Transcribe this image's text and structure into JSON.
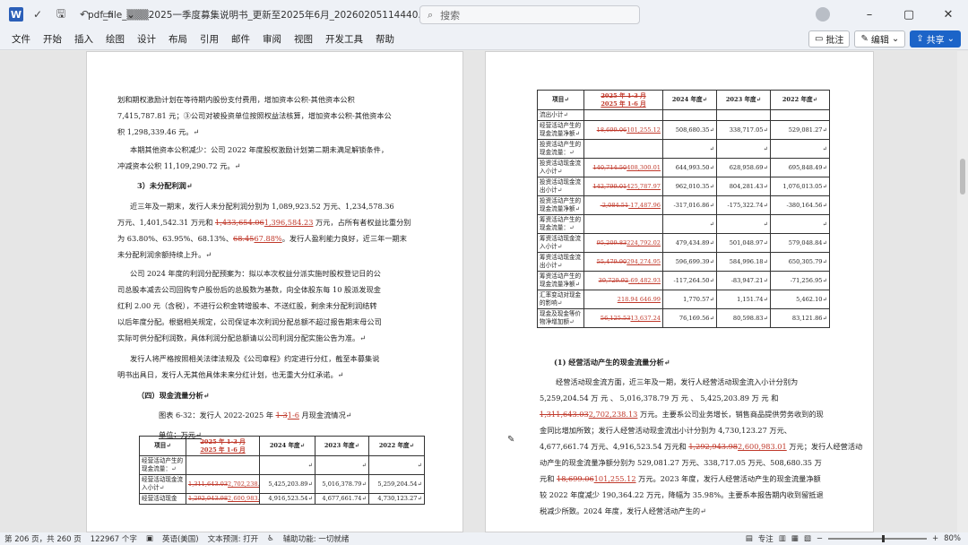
{
  "window": {
    "title": "pdf_file_▒▒▒2025一季度募集说明书_更新至2025年6月_20260205114440.docx - 兼容性...",
    "search_placeholder": "搜索"
  },
  "menu": [
    "文件",
    "开始",
    "插入",
    "绘图",
    "设计",
    "布局",
    "引用",
    "邮件",
    "审阅",
    "视图",
    "开发工具",
    "帮助"
  ],
  "ribbon_right": {
    "comment": "批注",
    "edit": "编辑",
    "share": "共享"
  },
  "left_page": {
    "p1a": "划和期权激励计划在等待期内股份支付费用，增加资本公积-其他资本公积",
    "p1b": "7,415,787.81 元；③公司对被投资单位按照权益法核算，增加资本公积-其他资本公",
    "p1c": "积 1,298,339.46 元。↵",
    "p2a": "本期其他资本公积减少：公司 2022 年度股权激励计划第二期未满足解锁条件，",
    "p2b": "冲减资本公积 11,109,290.72 元。↵",
    "h3": "3）未分配利润↵",
    "p3a": "近三年及一期末，发行人未分配利润分别为 1,089,923.52 万元、1,234,578.36",
    "p3b_1": "万元、1,401,542.31 万元和 ",
    "p3b_del": "1,433,654.06",
    "p3b_ins": "1,396,584.23",
    "p3b_2": " 万元，占所有者权益比重分别",
    "p3c_1": "为 63.80%、63.95%、68.13%、",
    "p3c_del": "68.45",
    "p3c_ins": "67.88%",
    "p3c_2": "。发行人盈利能力良好，近三年一期末",
    "p3d": "未分配利润余额持续上升。↵",
    "p4a": "公司 2024 年度的利润分配预案为：拟以本次权益分派实施时股权登记日的公",
    "p4b": "司总股本减去公司回购专户股份后的总股数为基数，向全体股东每 10 股派发现金",
    "p4c": "红利 2.00 元（含税），不进行公积金转增股本、不送红股，剩余未分配利润结转",
    "p4d": "以后年度分配。根据相关规定，公司保证本次利润分配总额不超过报告期末母公司",
    "p4e": "实际可供分配利润数，具体利润分配总额请以公司利润分配实施公告为准。↵",
    "p5a": "发行人将严格按照相关法律法规及《公司章程》约定进行分红，截至本募集说",
    "p5b": "明书出具日，发行人无其他具体未来分红计划，也无重大分红承诺。↵",
    "h4": "（四）现金流量分析↵",
    "cap_1": "图表 6-32：发行人 2022-2025 年 ",
    "cap_del": "1-3",
    "cap_ins": "1-6",
    "cap_2": " 月现金流情况↵",
    "unit": "单位：万元↵",
    "table": {
      "h0": "项目↵",
      "h1_del": "2025 年 1-3 月",
      "h1_ins": "2025 年 1-6 月",
      "h2": "2024 年度↵",
      "h3": "2023 年度↵",
      "h4": "2022 年度↵",
      "rows": [
        {
          "label": "经营活动产生的现金流量：↵",
          "del": "",
          "ins": "",
          "v2": "↵",
          "v3": "↵",
          "v4": "↵"
        },
        {
          "label": "经营活动现金流入小计↵",
          "del": "1,311,643.03",
          "ins": "2,702,238.13",
          "v2": "5,425,203.89↵",
          "v3": "5,016,378.79↵",
          "v4": "5,259,204.54↵"
        },
        {
          "label": "经营活动现金",
          "del": "1,292,943.98",
          "ins": "2,600,983.01",
          "v2": "4,916,523.54↵",
          "v3": "4,677,661.74↵",
          "v4": "4,730,123.27↵"
        }
      ]
    }
  },
  "right_page": {
    "table": {
      "h0": "项目↵",
      "h1_del": "2025 年 1-3 月",
      "h1_ins": "2025 年 1-6 月",
      "h2": "2024 年度↵",
      "h3": "2023 年度↵",
      "h4": "2022 年度↵",
      "rows": [
        {
          "label": "流出小计↵",
          "del": "",
          "ins": "",
          "v2": "",
          "v3": "",
          "v4": ""
        },
        {
          "label": "经营活动产生的现金流量净额↵",
          "del": "18,699.06",
          "ins": "101,255.12",
          "v2": "508,680.35↵",
          "v3": "338,717.05↵",
          "v4": "529,081.27↵"
        },
        {
          "label": "投资活动产生的现金流量：↵",
          "del": "",
          "ins": "",
          "v2": "↵",
          "v3": "↵",
          "v4": "↵"
        },
        {
          "label": "投资活动现金流入小计↵",
          "del": "140,714.50",
          "ins": "408,300.01",
          "v2": "644,993.50↵",
          "v3": "628,958.69↵",
          "v4": "695,848.49↵"
        },
        {
          "label": "投资活动现金流出小计↵",
          "del": "142,799.01",
          "ins": "425,787.97",
          "v2": "962,010.35↵",
          "v3": "804,281.43↵",
          "v4": "1,076,013.05↵"
        },
        {
          "label": "投资活动产生的现金流量净额↵",
          "del": "-2,084.51",
          "ins": "-17,487.96",
          "v2": "-317,016.86↵",
          "v3": "-175,322.74↵",
          "v4": "-380,164.56↵"
        },
        {
          "label": "筹资活动产生的现金流量：↵",
          "del": "",
          "ins": "",
          "v2": "↵",
          "v3": "↵",
          "v4": "↵"
        },
        {
          "label": "筹资活动现金流入小计↵",
          "del": "95,209.83",
          "ins": "224,792.02",
          "v2": "479,434.89↵",
          "v3": "501,048.97↵",
          "v4": "579,048.84↵"
        },
        {
          "label": "筹资活动现金流出小计↵",
          "del": "55,479.90",
          "ins": "294,274.95",
          "v2": "596,699.39↵",
          "v3": "584,996.18↵",
          "v4": "650,305.79↵"
        },
        {
          "label": "筹资活动产生的现金流量净额↵",
          "del": "39,729.92",
          "ins": "-69,482.93",
          "v2": "-117,264.50↵",
          "v3": "-83,947.21↵",
          "v4": "-71,256.95↵"
        },
        {
          "label": "汇率变动对现金的影响↵",
          "del": "",
          "ins": "218.94 646.99",
          "v2": "1,770.57↵",
          "v3": "1,151.74↵",
          "v4": "5,462.10↵"
        },
        {
          "label": "现金及现金等价物净增加额↵",
          "del": "56,125.53",
          "ins": "13,637.24",
          "v2": "76,169.56↵",
          "v3": "80,598.83↵",
          "v4": "83,121.86↵"
        }
      ]
    },
    "h1": "(1) 经营活动产生的现金流量分析↵",
    "q1": "经营活动现金流方面，近三年及一期，发行人经营活动现金流入小计分别为",
    "q2": "5,259,204.54     万   元   、  5,016,378.79   万   元   、  5,425,203.89   万   元   和",
    "q3_del": "1,311,643.03",
    "q3_ins": "2,702,238.13",
    "q3_2": " 万元。主要系公司业务增长，销售商品提供劳务收到的现",
    "q4": "金同比增加所致；发行人经营活动现金流出小计分别为 4,730,123.27 万元、",
    "q5_1": "4,677,661.74 万元、4,916,523.54 万元和 ",
    "q5_del": "1,292,943.98",
    "q5_ins": "2,600,983.01",
    "q5_2": " 万元；发行人经营活动",
    "q6": "动产生的现金流量净额分别为 529,081.27 万元、338,717.05 万元、508,680.35 万",
    "q7_1": "元和 ",
    "q7_del": "18,699.06",
    "q7_ins": "101,255.12",
    "q7_2": " 万元。2023 年度，发行人经营活动产生的现金流量净额",
    "q8": "较 2022 年度减少 190,364.22 万元，降幅为 35.98%。主要系本报告期内收到留抵退",
    "q9": "税减少所致。2024 年度，发行人经营活动产生的↵"
  },
  "status": {
    "page": "第 206 页，共 260 页",
    "words": "122967 个字",
    "lang": "英语(美国)",
    "predict": "文本预测: 打开",
    "access": "辅助功能: 一切就绪",
    "focus": "专注",
    "zoom": "80%"
  }
}
